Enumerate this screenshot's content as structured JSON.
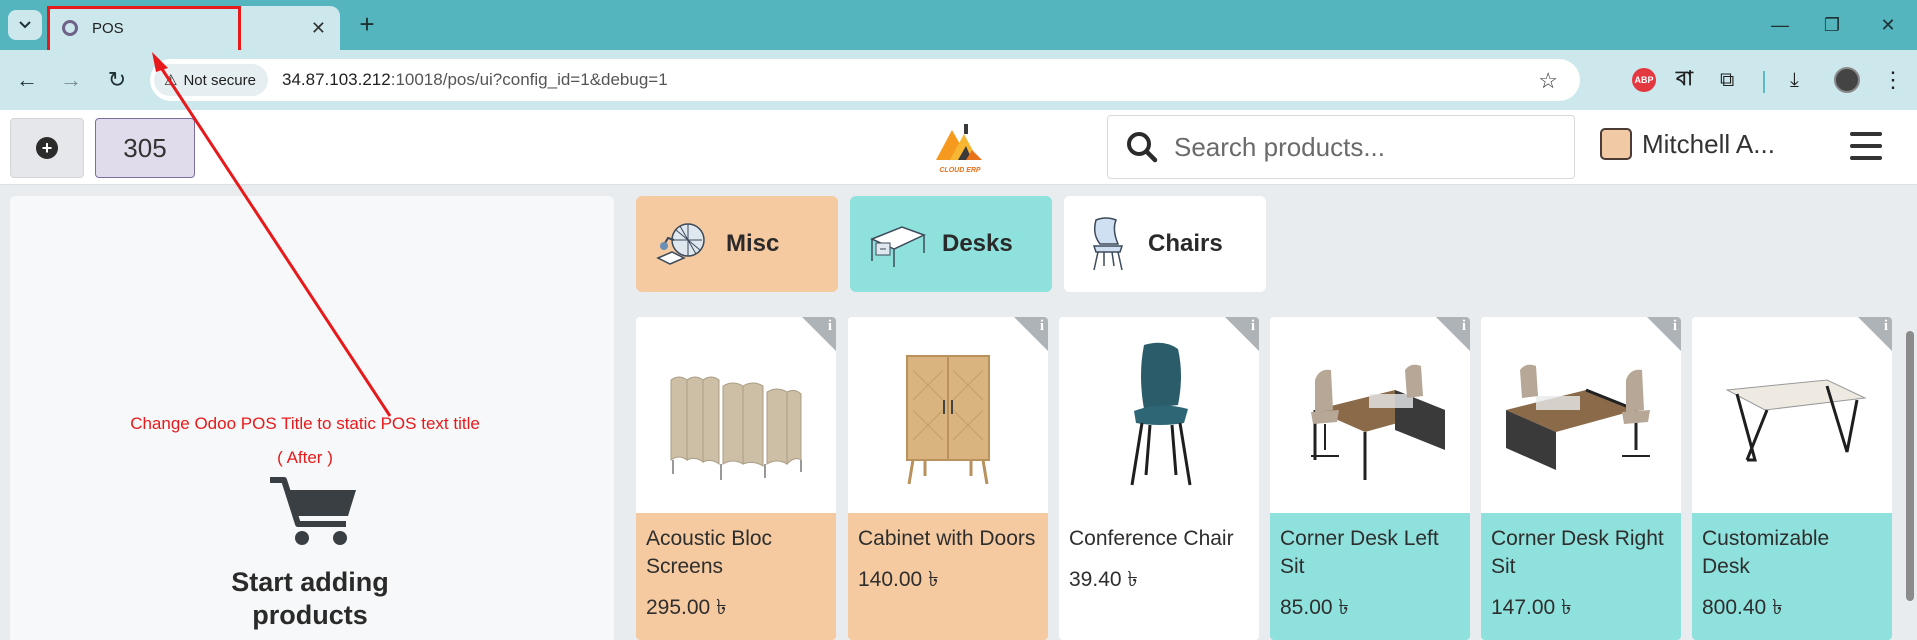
{
  "browser": {
    "tab": {
      "title": "POS"
    },
    "url_host": "34.87.103.212",
    "url_rest": ":10018/pos/ui?config_id=1&debug=1",
    "security_label": "Not secure",
    "extension_bn_label": "বা",
    "abp_label": "ABP"
  },
  "pos": {
    "order_number": "305",
    "search_placeholder": "Search products...",
    "user_name": "Mitchell A...",
    "logo_text": "CLOUD ERP",
    "empty_cart_text": "Start adding products",
    "annotation": {
      "line1": "Change Odoo POS Title to static POS text title",
      "line2": "( After )"
    },
    "categories": [
      {
        "label": "Misc",
        "color": "#f6caa1"
      },
      {
        "label": "Desks",
        "color": "#8ee1dc"
      },
      {
        "label": "Chairs",
        "color": "#ffffff"
      }
    ],
    "products": [
      {
        "name": "Acoustic Bloc Screens",
        "price": "295.00 ৳"
      },
      {
        "name": "Cabinet with Doors",
        "price": "140.00 ৳"
      },
      {
        "name": "Conference Chair",
        "price": "39.40 ৳"
      },
      {
        "name": "Corner Desk Left Sit",
        "price": "85.00 ৳"
      },
      {
        "name": "Corner Desk Right Sit",
        "price": "147.00 ৳"
      },
      {
        "name": "Customizable Desk",
        "price": "800.40 ৳"
      }
    ]
  },
  "colors": {
    "browser_frame": "#54b5bf",
    "annotation_red": "#e8191b",
    "misc": "#f6caa1",
    "desks": "#8ee1dc"
  }
}
